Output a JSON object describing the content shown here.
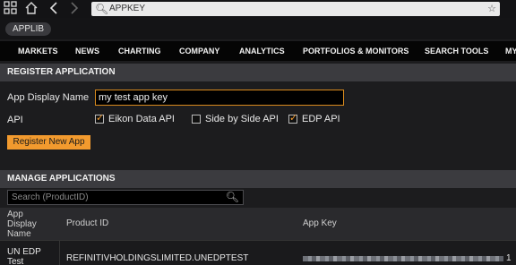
{
  "toolbar": {
    "icons": [
      "grid-icon",
      "home-icon",
      "back-icon",
      "forward-icon",
      "search-icon",
      "star-icon"
    ],
    "search_value": "APPKEY"
  },
  "app_tab": {
    "label": "APPLIB"
  },
  "nav": {
    "items": [
      "MARKETS",
      "NEWS",
      "CHARTING",
      "COMPANY",
      "ANALYTICS",
      "PORTFOLIOS & MONITORS",
      "SEARCH TOOLS",
      "MY"
    ]
  },
  "register": {
    "header": "REGISTER APPLICATION",
    "display_name_label": "App Display Name",
    "display_name_value": "my test app key",
    "api_label": "API",
    "apis": [
      {
        "label": "Eikon Data API",
        "checked": true
      },
      {
        "label": "Side by Side API",
        "checked": false
      },
      {
        "label": "EDP API",
        "checked": true
      }
    ],
    "button_label": "Register New App"
  },
  "manage": {
    "header": "MANAGE APPLICATIONS",
    "filter_placeholder": "Search (ProductID)",
    "columns": [
      "App Display Name",
      "Product ID",
      "App Key"
    ],
    "rows": [
      {
        "app_display_name": "UN EDP Test",
        "product_id": "REFINITIVHOLDINGSLIMITED.UNEDPTEST",
        "app_key_tail": "1"
      }
    ]
  },
  "colors": {
    "accent": "#f29a2e",
    "nav_bg": "#050505",
    "section_bg": "#3b3b3f"
  }
}
